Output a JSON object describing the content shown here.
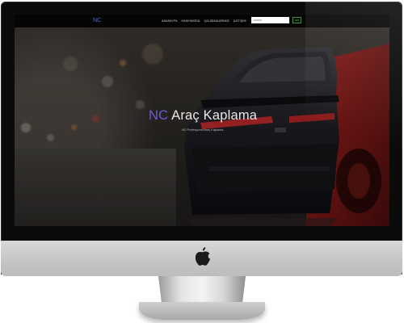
{
  "site": {
    "logo": "NC",
    "nav": [
      "ANASAYFA",
      "HAKKIMIZDA",
      "ÇALIŞMALARIMIZ",
      "İLETİŞİM"
    ],
    "search": {
      "placeholder": "arama",
      "button_label": "Ara"
    },
    "hero": {
      "title_brand": "NC",
      "title_rest": "Araç Kaplama",
      "subtitle": "NC Profesyonel Araç Kaplama"
    }
  },
  "device": {
    "logo": "apple-icon"
  },
  "colors": {
    "brand": "#6a5bd0",
    "accent_green": "#46b046",
    "logo_blue": "#4a6fd6"
  }
}
